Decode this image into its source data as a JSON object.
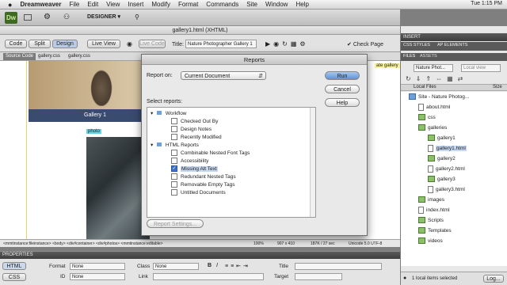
{
  "menubar": {
    "apple_icon": "apple-icon",
    "app_name": "Dreamweaver",
    "items": [
      "File",
      "Edit",
      "View",
      "Insert",
      "Modify",
      "Format",
      "Commands",
      "Site",
      "Window",
      "Help"
    ],
    "clock": "Tue 1:15 PM"
  },
  "app_toolbar": {
    "logo": "Dw",
    "workspace": "DESIGNER"
  },
  "document": {
    "title": "gallery1.html (XHTML)",
    "view_buttons": [
      "Code",
      "Split",
      "Design"
    ],
    "live_view": "Live View",
    "live_code": "Live Code",
    "title_label": "Title:",
    "title_value": "Nature Photographer Gallery 1",
    "check_page": "Check Page",
    "related_files": [
      "Source Code",
      "gallery.css",
      "gallery.css"
    ],
    "tag_bar": "<mmtinstance:fileinstance> <body> <div#container> <div#photos> <mmtinstance:editable>",
    "zoom": "100%",
    "size": "907 x 410",
    "file_info": "187K / 27 sec",
    "encoding": "Unicode 5.0 UTF-8"
  },
  "design_view": {
    "gallery_label": "Gallery 1",
    "photo_tag": "photo",
    "update_note": "ate gallery"
  },
  "dialog": {
    "title": "Reports",
    "report_on_label": "Report on:",
    "report_on_value": "Current Document",
    "select_label": "Select reports:",
    "run": "Run",
    "cancel": "Cancel",
    "help": "Help",
    "report_settings": "Report Settings...",
    "groups": [
      {
        "label": "Workflow",
        "items": [
          "Checked Out By",
          "Design Notes",
          "Recently Modified"
        ]
      },
      {
        "label": "HTML Reports",
        "items": [
          "Combinable Nested Font Tags",
          "Accessibility",
          "Missing Alt Text",
          "Redundant Nested Tags",
          "Removable Empty Tags",
          "Untitled Documents"
        ]
      }
    ],
    "checked_item": "Missing Alt Text"
  },
  "properties": {
    "header": "PROPERTIES",
    "html_tab": "HTML",
    "css_tab": "CSS",
    "format_label": "Format",
    "format_value": "None",
    "id_label": "ID",
    "id_value": "None",
    "class_label": "Class",
    "class_value": "None",
    "link_label": "Link",
    "title_label": "Title",
    "target_label": "Target"
  },
  "right_panel": {
    "insert": "INSERT",
    "css_styles": "CSS STYLES",
    "ap_elements": "AP ELEMENTS",
    "files": "FILES",
    "assets": "ASSETS",
    "site_select": "Nature Phot...",
    "view_select": "Local view",
    "col_local": "Local Files",
    "col_size": "Size",
    "tree": [
      {
        "label": "Site - Nature Photog...",
        "level": 0,
        "type": "site"
      },
      {
        "label": "about.html",
        "level": 1,
        "type": "file"
      },
      {
        "label": "css",
        "level": 1,
        "type": "folder"
      },
      {
        "label": "galleries",
        "level": 1,
        "type": "folder"
      },
      {
        "label": "gallery1",
        "level": 2,
        "type": "folder"
      },
      {
        "label": "gallery1.html",
        "level": 2,
        "type": "file"
      },
      {
        "label": "gallery2",
        "level": 2,
        "type": "folder"
      },
      {
        "label": "gallery2.html",
        "level": 2,
        "type": "file"
      },
      {
        "label": "gallery3",
        "level": 2,
        "type": "folder"
      },
      {
        "label": "gallery3.html",
        "level": 2,
        "type": "file"
      },
      {
        "label": "images",
        "level": 1,
        "type": "folder"
      },
      {
        "label": "index.html",
        "level": 1,
        "type": "file"
      },
      {
        "label": "Scripts",
        "level": 1,
        "type": "folder"
      },
      {
        "label": "Templates",
        "level": 1,
        "type": "folder"
      },
      {
        "label": "videos",
        "level": 1,
        "type": "folder"
      }
    ],
    "selected": "gallery1.html",
    "status": "1 local items selected",
    "log_button": "Log..."
  },
  "colors": {
    "selection": "#3d72c6",
    "dw_green": "#3e6b21",
    "gallery_bar": "#3a4b70"
  }
}
